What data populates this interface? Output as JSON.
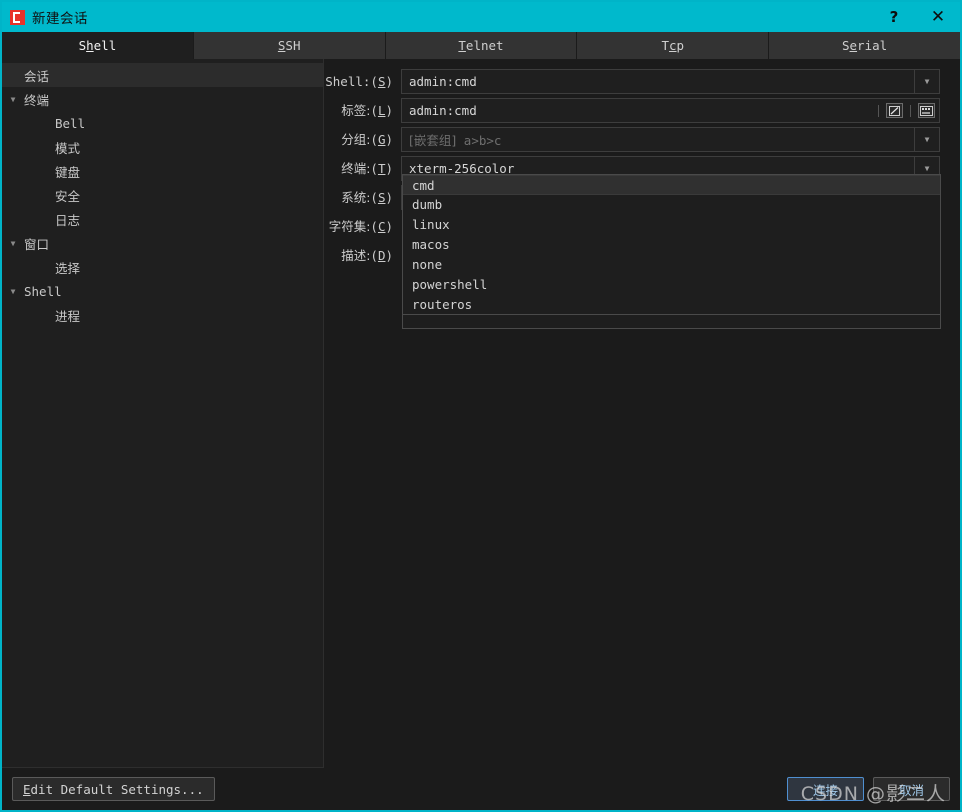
{
  "window": {
    "title": "新建会话",
    "icon": "app-logo-icon",
    "help_label": "?",
    "close_label": "✕",
    "accent_color": "#00b9cc",
    "background_color": "#1b1b1b"
  },
  "tabs": [
    {
      "label": "Shell",
      "mnemonic_index": 1,
      "active": true
    },
    {
      "label": "SSH",
      "mnemonic_index": 0,
      "active": false
    },
    {
      "label": "Telnet",
      "mnemonic_index": 0,
      "active": false
    },
    {
      "label": "Tcp",
      "mnemonic_index": 1,
      "active": false
    },
    {
      "label": "Serial",
      "mnemonic_index": 1,
      "active": false
    }
  ],
  "sidebar": {
    "items": [
      {
        "label": "会话",
        "level": 0,
        "expander": "",
        "selected": true,
        "mono": false
      },
      {
        "label": "终端",
        "level": 0,
        "expander": "▼",
        "selected": false,
        "mono": false
      },
      {
        "label": "Bell",
        "level": 2,
        "expander": "",
        "selected": false,
        "mono": true
      },
      {
        "label": "模式",
        "level": 2,
        "expander": "",
        "selected": false,
        "mono": false
      },
      {
        "label": "键盘",
        "level": 2,
        "expander": "",
        "selected": false,
        "mono": false
      },
      {
        "label": "安全",
        "level": 2,
        "expander": "",
        "selected": false,
        "mono": false
      },
      {
        "label": "日志",
        "level": 2,
        "expander": "",
        "selected": false,
        "mono": false
      },
      {
        "label": "窗口",
        "level": 0,
        "expander": "▼",
        "selected": false,
        "mono": false
      },
      {
        "label": "选择",
        "level": 2,
        "expander": "",
        "selected": false,
        "mono": false
      },
      {
        "label": "Shell",
        "level": 0,
        "expander": "▼",
        "selected": false,
        "mono": true
      },
      {
        "label": "进程",
        "level": 2,
        "expander": "",
        "selected": false,
        "mono": false
      }
    ]
  },
  "form": {
    "rows": [
      {
        "label_text": "Shell:",
        "label_mnemonic": "(S)",
        "label_is_cjk": false,
        "value": "admin:cmd",
        "placeholder": "",
        "control": "combobox"
      },
      {
        "label_text": "标签:",
        "label_mnemonic": "(L)",
        "label_is_cjk": true,
        "value": "admin:cmd",
        "placeholder": "",
        "control": "text-with-icons",
        "icons": [
          "edit-pencil-icon",
          "keyboard-icon"
        ]
      },
      {
        "label_text": "分组:",
        "label_mnemonic": "(G)",
        "label_is_cjk": true,
        "value": "",
        "placeholder_cjk": "[嵌套组]",
        "placeholder_rest": " a>b>c",
        "control": "combobox"
      },
      {
        "label_text": "终端:",
        "label_mnemonic": "(T)",
        "label_is_cjk": true,
        "value": "xterm-256color",
        "placeholder": "",
        "control": "combobox"
      },
      {
        "label_text": "系统:",
        "label_mnemonic": "(S)",
        "label_is_cjk": true,
        "value": "cmd",
        "placeholder": "",
        "control": "combobox-open"
      },
      {
        "label_text": "字符集:",
        "label_mnemonic": "(C)",
        "label_is_cjk": true,
        "value": "",
        "placeholder": "",
        "control": "combobox-hidden"
      },
      {
        "label_text": "描述:",
        "label_mnemonic": "(D)",
        "label_is_cjk": true,
        "value": "",
        "placeholder": "",
        "control": "combobox-hidden"
      }
    ]
  },
  "dropdown": {
    "open": true,
    "selected": "cmd",
    "options": [
      "cmd",
      "dumb",
      "linux",
      "macos",
      "none",
      "powershell",
      "routeros"
    ]
  },
  "footer": {
    "edit_defaults_label": "Edit Default Settings...",
    "connect_label": "连接",
    "cancel_label": "取消"
  },
  "watermark": {
    "text": "CSDN @影二人"
  }
}
